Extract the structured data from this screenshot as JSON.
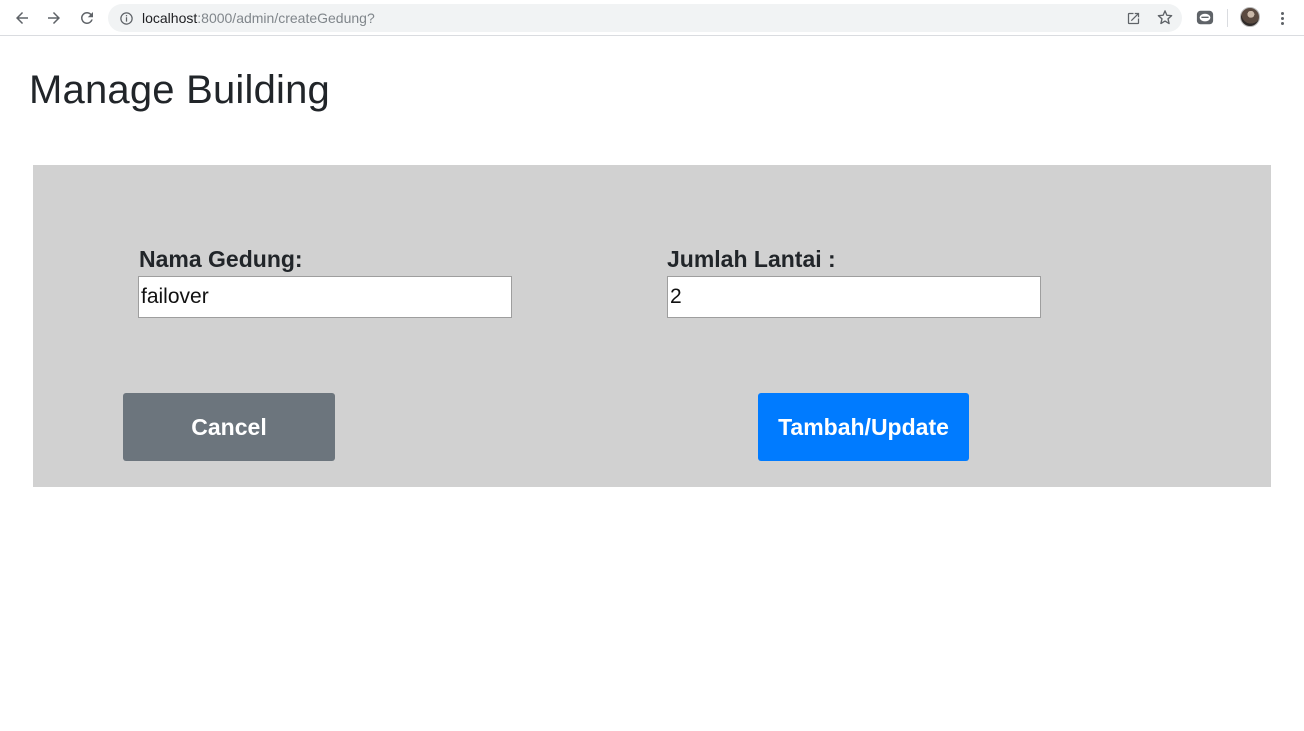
{
  "browser": {
    "url_host": "localhost",
    "url_path": ":8000/admin/createGedung?",
    "icons": {
      "back": "back-arrow-icon",
      "forward": "forward-arrow-icon",
      "reload": "reload-icon",
      "info": "info-icon",
      "open_external": "open-external-icon",
      "bookmark": "star-icon",
      "extension": "line-extension-icon",
      "menu": "more-vert-icon"
    }
  },
  "page": {
    "title": "Manage Building"
  },
  "form": {
    "nama_gedung": {
      "label": "Nama Gedung:",
      "value": "failover"
    },
    "jumlah_lantai": {
      "label": "Jumlah Lantai :",
      "value": "2"
    },
    "cancel_label": "Cancel",
    "submit_label": "Tambah/Update"
  },
  "colors": {
    "panel_bg": "#d1d1d1",
    "cancel_bg": "#6c757d",
    "submit_bg": "#007bff"
  }
}
